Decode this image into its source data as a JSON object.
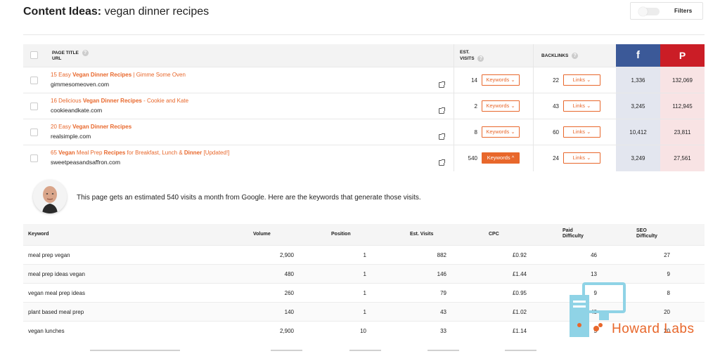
{
  "header": {
    "title_bold": "Content Ideas:",
    "title_rest": "vegan dinner recipes",
    "filters_label": "Filters"
  },
  "table": {
    "col_page_title": "PAGE TITLE",
    "col_url": "URL",
    "col_visits_1": "EST.",
    "col_visits_2": "VISITS",
    "col_backlinks": "BACKLINKS",
    "facebook_glyph": "f",
    "pinterest_glyph": "P",
    "rows": [
      {
        "t_pre": "15 Easy ",
        "t_bold": "Vegan Dinner Recipes",
        "t_post": " | Gimme Some Oven",
        "url": "gimmesomeoven.com",
        "visits": "14",
        "keywords": "Keywords ⌄",
        "backlinks": "22",
        "links": "Links ⌄",
        "fb": "1,336",
        "pin": "132,069"
      },
      {
        "t_pre": "16 Delicious ",
        "t_bold": "Vegan Dinner Recipes",
        "t_post": " - Cookie and Kate",
        "url": "cookieandkate.com",
        "visits": "2",
        "keywords": "Keywords ⌄",
        "backlinks": "43",
        "links": "Links ⌄",
        "fb": "3,245",
        "pin": "112,945"
      },
      {
        "t_pre": "20 Easy ",
        "t_bold": "Vegan Dinner Recipes",
        "t_post": "",
        "url": "realsimple.com",
        "visits": "8",
        "keywords": "Keywords ⌄",
        "backlinks": "60",
        "links": "Links ⌄",
        "fb": "10,412",
        "pin": "23,811"
      },
      {
        "t_pre": "65 ",
        "t_bold": "Vegan",
        "t_mid": " Meal Prep ",
        "t_bold2": "Recipes",
        "t_mid2": " for Breakfast, Lunch & ",
        "t_bold3": "Dinner",
        "t_post": " [Updated!]",
        "url": "sweetpeasandsaffron.com",
        "visits": "540",
        "keywords": "Keywords ^",
        "backlinks": "24",
        "links": "Links ⌄",
        "fb": "3,249",
        "pin": "27,561"
      }
    ]
  },
  "message": "This page gets an estimated 540 visits a month from Google. Here are the keywords that generate those visits.",
  "keywords": {
    "h_keyword": "Keyword",
    "h_volume": "Volume",
    "h_position": "Position",
    "h_visits": "Est. Visits",
    "h_cpc": "CPC",
    "h_paid_1": "Paid",
    "h_paid_2": "Difficulty",
    "h_seo_1": "SEO",
    "h_seo_2": "Difficulty",
    "rows": [
      {
        "keyword": "meal prep vegan",
        "volume": "2,900",
        "position": "1",
        "visits": "882",
        "cpc": "£0.92",
        "paid": "46",
        "seo": "27"
      },
      {
        "keyword": "meal prep ideas vegan",
        "volume": "480",
        "position": "1",
        "visits": "146",
        "cpc": "£1.44",
        "paid": "13",
        "seo": "9"
      },
      {
        "keyword": "vegan meal prep ideas",
        "volume": "260",
        "position": "1",
        "visits": "79",
        "cpc": "£0.95",
        "paid": "9",
        "seo": "8"
      },
      {
        "keyword": "plant based meal prep",
        "volume": "140",
        "position": "1",
        "visits": "43",
        "cpc": "£1.02",
        "paid": "48",
        "seo": "20"
      },
      {
        "keyword": "vegan lunches",
        "volume": "2,900",
        "position": "10",
        "visits": "33",
        "cpc": "£1.14",
        "paid": "5",
        "seo": "20"
      }
    ]
  },
  "watermark": {
    "text": "Howard Labs"
  },
  "colors": {
    "accent": "#e8672b",
    "facebook": "#3b5998",
    "pinterest": "#cb1d26"
  }
}
